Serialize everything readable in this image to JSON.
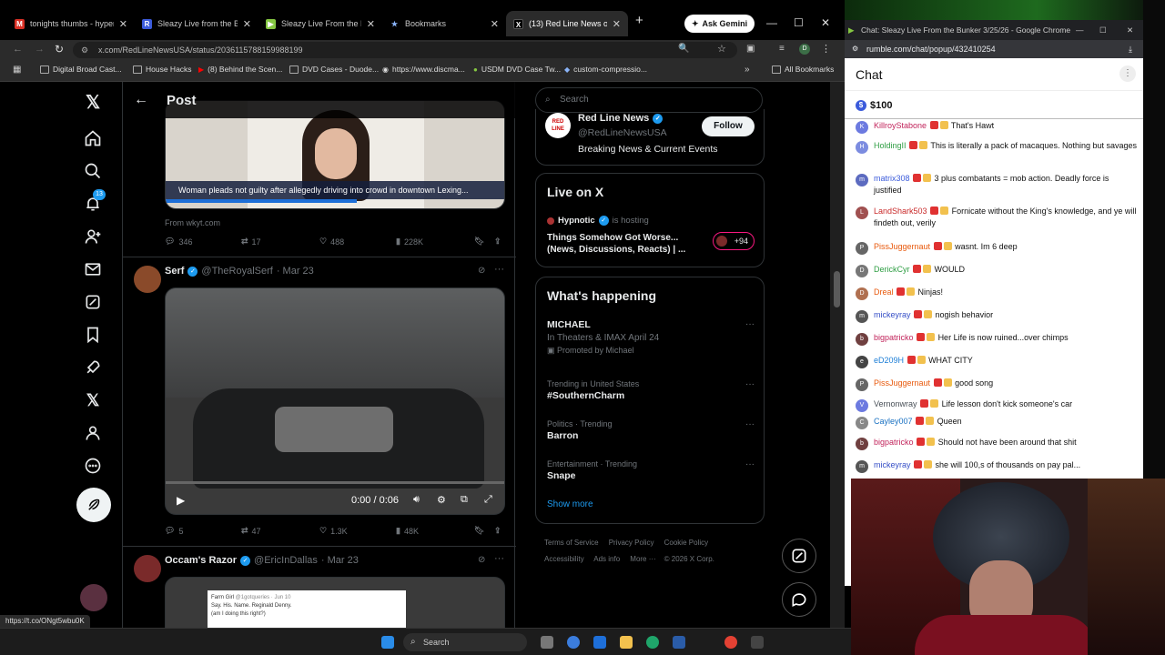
{
  "browser": {
    "tabs": [
      {
        "label": "tonights thumbs - hyperc",
        "favicon_color": "#d93025"
      },
      {
        "label": "Sleazy Live from the Bunk",
        "favicon_color": "#3b5bdb"
      },
      {
        "label": "Sleazy Live From the Bunk",
        "favicon_color": "#85c742"
      },
      {
        "label": "Bookmarks",
        "favicon_color": "#8ab4f8"
      },
      {
        "label": "(13) Red Line News on X:",
        "favicon_color": "#000000"
      }
    ],
    "gemini_label": "Ask Gemini",
    "url": "x.com/RedLineNewsUSA/status/2036115788159988199",
    "bookmarks": [
      "Digital Broad Cast...",
      "House Hacks",
      "(8) Behind the Scen...",
      "DVD Cases - Duode...",
      "https://www.discma...",
      "USDM DVD Case Tw...",
      "custom-compressio..."
    ],
    "all_bookmarks": "All Bookmarks",
    "status_url": "https://t.co/ONgt5wbu0K"
  },
  "x": {
    "header_title": "Post",
    "notification_count": "13",
    "tweet1": {
      "caption": "Woman pleads not guilty after allegedly driving into crowd in downtown Lexing...",
      "source": "From wkyt.com",
      "replies": "346",
      "reposts": "17",
      "likes": "488",
      "views": "228K"
    },
    "tweet2": {
      "name": "Serf",
      "handle": "@TheRoyalSerf",
      "date": "· Mar 23",
      "time": "0:00 / 0:06",
      "replies": "5",
      "reposts": "47",
      "likes": "1.3K",
      "views": "48K"
    },
    "tweet3": {
      "name": "Occam's Razor",
      "handle": "@EricInDallas",
      "date": "· Mar 23",
      "quote_name": "Farm Girl",
      "quote_handle": "@1gotqueries · Jun 10",
      "quote_text": "Say. His. Name. Reginald Denny.",
      "quote_sub": "(am I doing this right?)"
    },
    "search_placeholder": "Search",
    "follow_card": {
      "name": "Red Line News",
      "handle": "@RedLineNewsUSA",
      "bio": "Breaking News & Current Events",
      "button": "Follow"
    },
    "live": {
      "heading": "Live on X",
      "host": "Hypnotic",
      "hosting": "is hosting",
      "title": "Things Somehow Got Worse... (News, Discussions, Reacts) | ...",
      "count": "+94"
    },
    "happening": {
      "heading": "What's happening",
      "trends": [
        {
          "top": "MICHAEL",
          "main": "In Theaters & IMAX April 24",
          "sub": "Promoted by Michael"
        },
        {
          "top": "Trending in United States",
          "main": "#SouthernCharm"
        },
        {
          "top": "Politics · Trending",
          "main": "Barron"
        },
        {
          "top": "Entertainment · Trending",
          "main": "Snape"
        }
      ],
      "show_more": "Show more"
    },
    "footer": [
      "Terms of Service",
      "Privacy Policy",
      "Cookie Policy",
      "Accessibility",
      "Ads info",
      "More ···",
      "© 2026 X Corp."
    ]
  },
  "taskbar": {
    "search": "Search"
  },
  "chat": {
    "window_title": "Chat: Sleazy Live From the Bunker 3/25/26 - Google Chrome",
    "url": "rumble.com/chat/popup/432410254",
    "heading": "Chat",
    "rant": "$100",
    "messages": [
      {
        "user": "KillroyStabone",
        "text": "That's Hawt",
        "color": "#c2255c",
        "av": "#6c7ae0"
      },
      {
        "user": "HoldingII",
        "text": "This is literally a pack of macaques. Nothing but savages",
        "color": "#2f9e44",
        "av": "#7c8ce0"
      },
      {
        "user": "matrix308",
        "text": "3 plus combatants = mob action. Deadly force is justified",
        "color": "#3b5bdb",
        "av": "#5c6bc0"
      },
      {
        "user": "LandShark503",
        "text": "Fornicate without the King's knowledge, and ye will findeth out, verily",
        "color": "#c92a2a",
        "av": "#a05050"
      },
      {
        "user": "PissJuggernaut",
        "text": "wasnt. Im 6 deep",
        "color": "#e8590c",
        "av": "#666666"
      },
      {
        "user": "DerickCyr",
        "text": "WOULD",
        "color": "#2f9e44",
        "av": "#777777"
      },
      {
        "user": "Dreal",
        "text": "Ninjas!",
        "color": "#e8590c",
        "av": "#b07050"
      },
      {
        "user": "mickeyray",
        "text": "nogish behavior",
        "color": "#364fc7",
        "av": "#555555"
      },
      {
        "user": "bigpatricko",
        "text": "Her Life is now ruined...over chimps",
        "color": "#c2255c",
        "av": "#704040"
      },
      {
        "user": "eD209H",
        "text": "WHAT CITY",
        "color": "#1c7ed6",
        "av": "#444444"
      },
      {
        "user": "PissJuggernaut",
        "text": "good song",
        "color": "#e8590c",
        "av": "#666666"
      },
      {
        "user": "Vernonwray",
        "text": "Life lesson don't kick someone's car",
        "color": "#495057",
        "av": "#6c7ae0"
      },
      {
        "user": "Cayley007",
        "text": "Queen",
        "color": "#1971c2",
        "av": "#888888"
      },
      {
        "user": "bigpatricko",
        "text": "Should not have been around that shit",
        "color": "#c2255c",
        "av": "#704040"
      },
      {
        "user": "mickeyray",
        "text": "she will 100,s of thousands on pay pal...",
        "color": "#364fc7",
        "av": "#555555"
      }
    ]
  }
}
